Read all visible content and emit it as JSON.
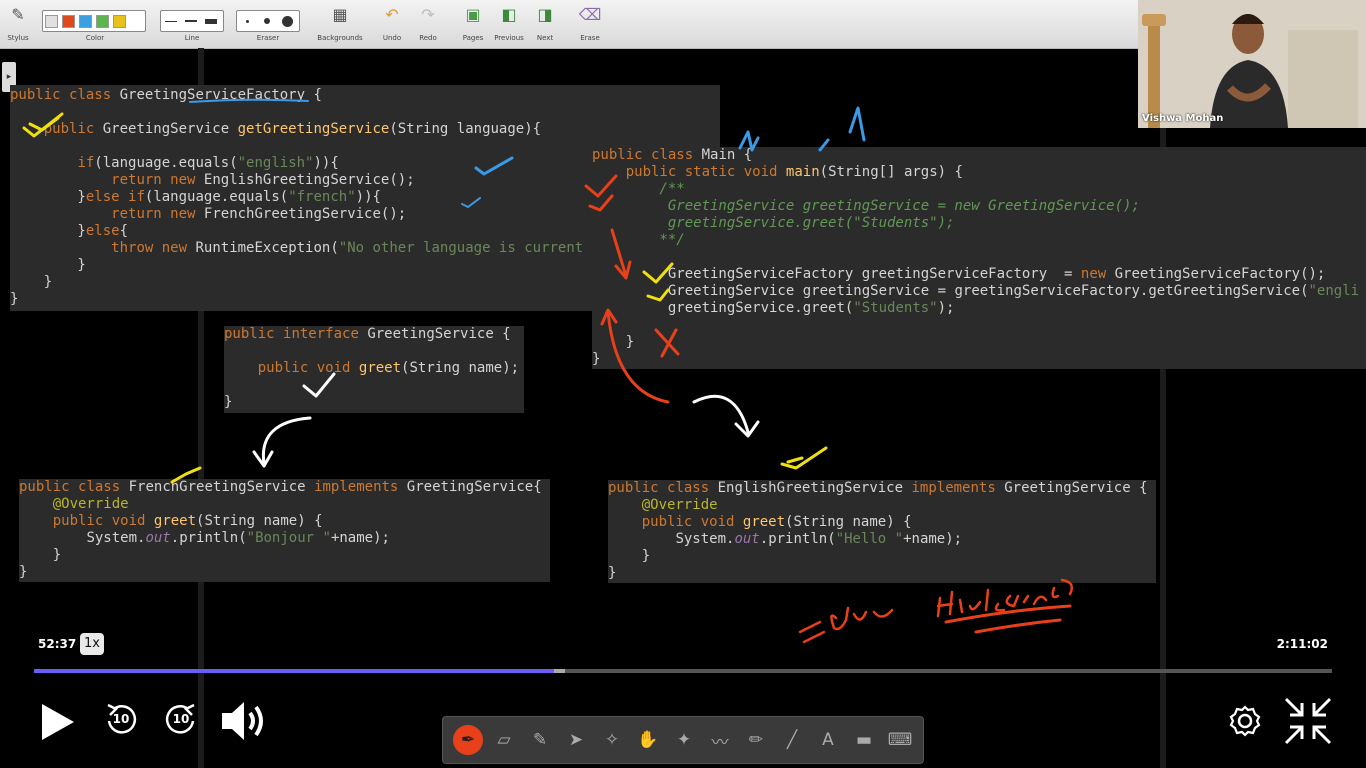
{
  "toolbar": {
    "items": [
      {
        "label": "Stylus"
      },
      {
        "label": "Color"
      },
      {
        "label": "Line"
      },
      {
        "label": "Eraser"
      },
      {
        "label": "Backgrounds"
      },
      {
        "label": "Undo"
      },
      {
        "label": "Redo"
      },
      {
        "label": "Pages"
      },
      {
        "label": "Previous"
      },
      {
        "label": "Next"
      },
      {
        "label": "Erase"
      }
    ],
    "colors": [
      "#ffffff",
      "#e04a1a",
      "#3aa0e0",
      "#5ab54a",
      "#e8c21a"
    ]
  },
  "webcam": {
    "name": "Vishwa Mohan"
  },
  "code": {
    "factory": [
      "public class GreetingServiceFactory {",
      "",
      "    public GreetingService getGreetingService(String language){",
      "",
      "        if(language.equals(\"english\")){",
      "            return new EnglishGreetingService();",
      "        }else if(language.equals(\"french\")){",
      "            return new FrenchGreetingService();",
      "        }else{",
      "            throw new RuntimeException(\"No other language is current",
      "        }",
      "    }",
      "}"
    ],
    "main": [
      "public class Main {",
      "    public static void main(String[] args) {",
      "        /**",
      "         GreetingService greetingService = new GreetingService();",
      "         greetingService.greet(\"Students\");",
      "        **/",
      "",
      "         GreetingServiceFactory greetingServiceFactory  = new GreetingServiceFactory();",
      "         GreetingService greetingService = greetingServiceFactory.getGreetingService(\"engli",
      "         greetingService.greet(\"Students\");",
      "",
      "    }",
      "}"
    ],
    "interface": [
      "public interface GreetingService {",
      "",
      "    public void greet(String name);",
      "",
      "}"
    ],
    "french": [
      "public class FrenchGreetingService implements GreetingService{",
      "    @Override",
      "    public void greet(String name) {",
      "        System.out.println(\"Bonjour \"+name);",
      "    }",
      "}"
    ],
    "english": [
      "public class EnglishGreetingService implements GreetingService {",
      "    @Override",
      "    public void greet(String name) {",
      "        System.out.println(\"Hello \"+name);",
      "    }",
      "}"
    ]
  },
  "player": {
    "current_time": "52:37",
    "total_time": "2:11:02",
    "speed": "1x",
    "progress_fraction": 0.401,
    "buffered_fraction": 0.409,
    "skip_back": "10",
    "skip_forward": "10"
  },
  "draw_tools": [
    "pen-icon",
    "eraser-icon",
    "highlighter-icon",
    "pointer-icon",
    "laser-icon",
    "hand-icon",
    "magic-wand-icon",
    "brush-icon",
    "pencil-icon",
    "line-icon",
    "text-icon",
    "shape-icon",
    "keyboard-icon"
  ]
}
